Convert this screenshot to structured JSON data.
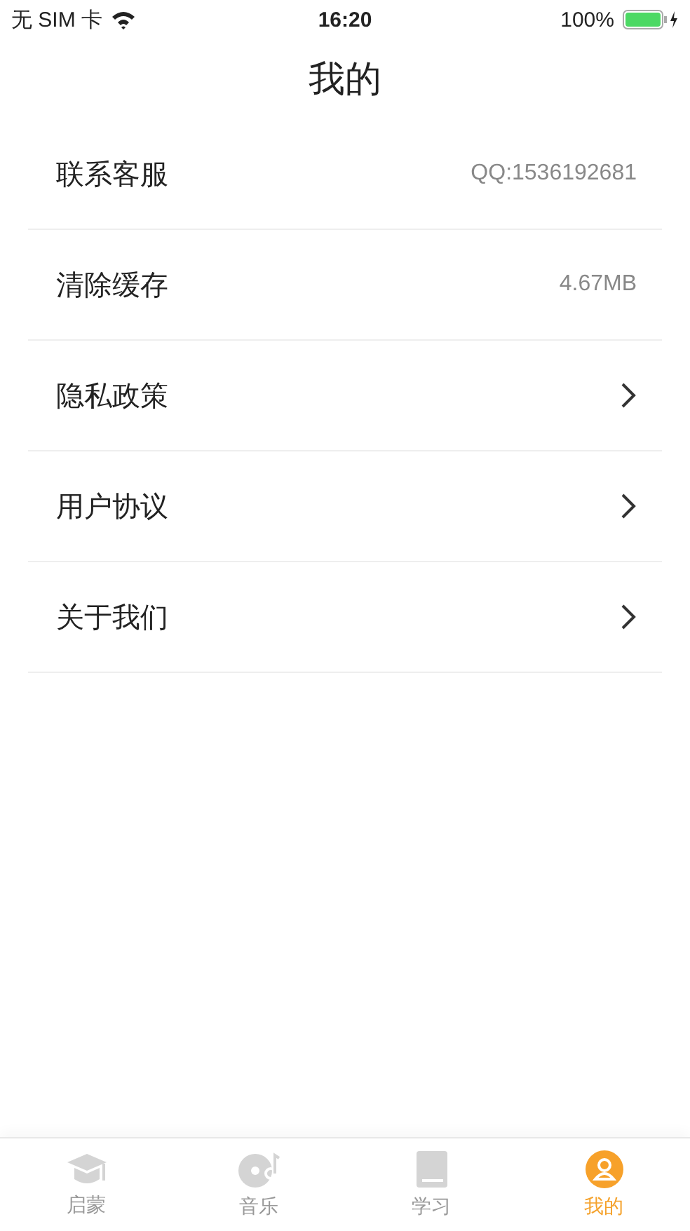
{
  "status_bar": {
    "carrier": "无 SIM 卡",
    "time": "16:20",
    "battery": "100%"
  },
  "title": "我的",
  "items": [
    {
      "label": "联系客服",
      "kind": "value",
      "value": "QQ:1536192681"
    },
    {
      "label": "清除缓存",
      "kind": "value",
      "value": "4.67MB"
    },
    {
      "label": "隐私政策",
      "kind": "link"
    },
    {
      "label": "用户协议",
      "kind": "link"
    },
    {
      "label": "关于我们",
      "kind": "link"
    }
  ],
  "tabs": [
    {
      "label": "启蒙",
      "kind": "cap",
      "selected": false
    },
    {
      "label": "音乐",
      "kind": "disc",
      "selected": false
    },
    {
      "label": "学习",
      "kind": "book",
      "selected": false
    },
    {
      "label": "我的",
      "kind": "person",
      "selected": true
    }
  ]
}
